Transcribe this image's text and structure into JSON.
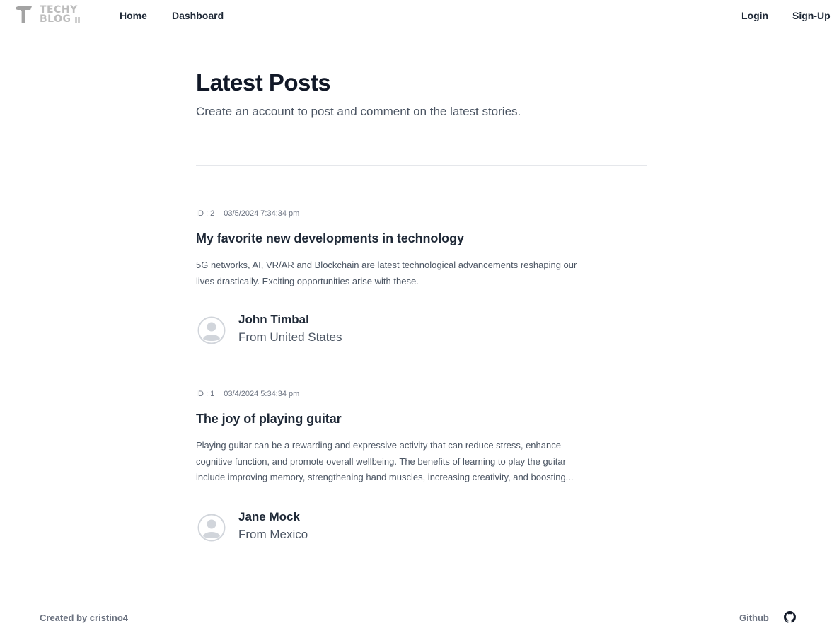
{
  "header": {
    "logo": {
      "line1": "TECHY",
      "line2": "BLOG",
      "icon": "techy-blog-logo"
    },
    "nav_left": {
      "home": "Home",
      "dashboard": "Dashboard"
    },
    "nav_right": {
      "login": "Login",
      "signup": "Sign-Up"
    }
  },
  "main": {
    "title": "Latest Posts",
    "subtitle": "Create an account to post and comment on the latest stories."
  },
  "posts": [
    {
      "id_label": "ID : 2",
      "date": "03/5/2024 7:34:34 pm",
      "title": "My favorite new developments in technology",
      "body": "5G networks, AI, VR/AR and Blockchain are latest technological advancements reshaping our lives drastically. Exciting opportunities arise with these.",
      "author": {
        "name": "John Timbal",
        "location": "From United States",
        "avatar_icon": "user-avatar-icon"
      }
    },
    {
      "id_label": "ID : 1",
      "date": "03/4/2024 5:34:34 pm",
      "title": "The joy of playing guitar",
      "body": "Playing guitar can be a rewarding and expressive activity that can reduce stress, enhance cognitive function, and promote overall wellbeing. The benefits of learning to play the guitar include improving memory, strengthening hand muscles, increasing creativity, and boosting...",
      "author": {
        "name": "Jane Mock",
        "location": "From Mexico",
        "avatar_icon": "user-avatar-icon"
      }
    }
  ],
  "footer": {
    "created_by": "Created by cristino4",
    "github_label": "Github",
    "github_icon": "github-icon"
  },
  "colors": {
    "text_primary": "#111827",
    "text_secondary": "#4b5563",
    "text_muted": "#6b7280",
    "logo_gray": "#bdbdbd",
    "avatar_gray": "#d1d5db"
  }
}
